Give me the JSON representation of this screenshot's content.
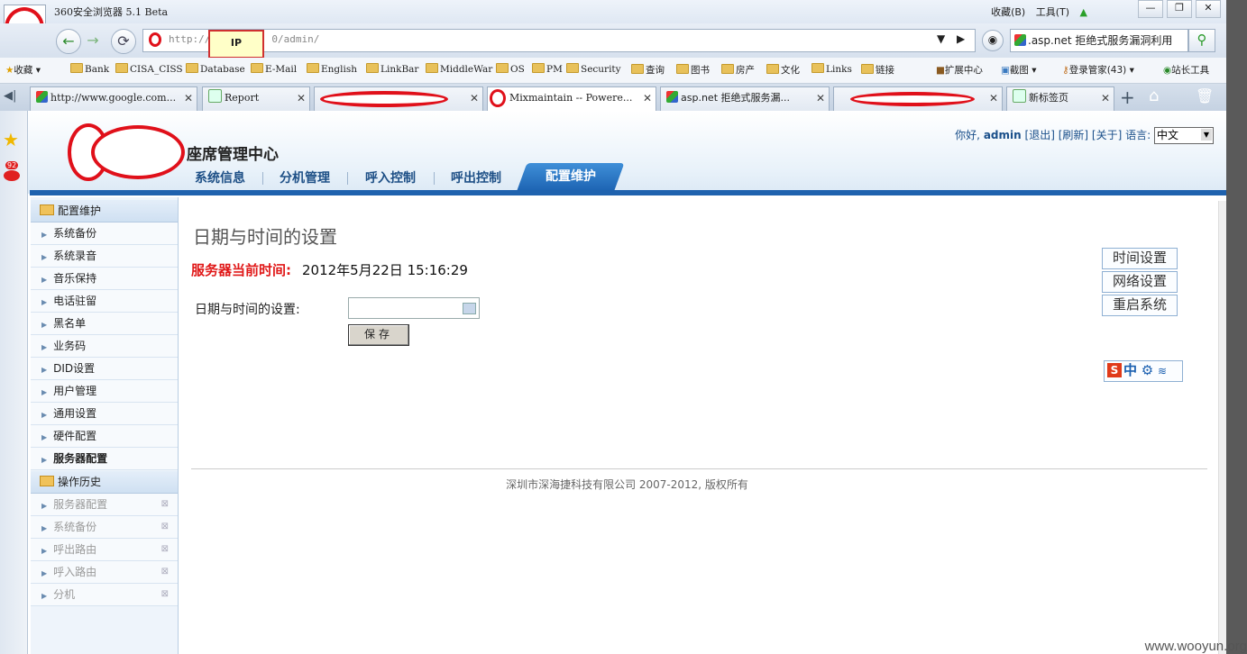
{
  "browser": {
    "title": "360安全浏览器 5.1 Beta",
    "menu": [
      "收藏(B)",
      "工具(T)"
    ],
    "address": "http://",
    "address_suffix": "0/admin/",
    "ip_tip": "IP",
    "search_text": ".asp.net 拒绝式服务漏洞利用"
  },
  "bookmarks": [
    "收藏",
    "Bank",
    "CISA_CISS",
    "Database",
    "E-Mail",
    "English",
    "LinkBar",
    "MiddleWar",
    "OS",
    "PM",
    "Security",
    "查询",
    "图书",
    "房产",
    "文化",
    "Links",
    "链接"
  ],
  "bookmarks_right": [
    "扩展中心",
    "截图",
    "登录管家(43)",
    "站长工具"
  ],
  "tabs": [
    {
      "label": "http://www.google.com..."
    },
    {
      "label": "Report"
    },
    {
      "label": ""
    },
    {
      "label": "Mixmaintain -- Powere..."
    },
    {
      "label": "asp.net 拒绝式服务漏..."
    },
    {
      "label": ""
    },
    {
      "label": "新标签页"
    }
  ],
  "badge": "92",
  "site": {
    "title": "座席管理中心",
    "greeting": "你好,",
    "user": "admin",
    "links": [
      "[退出]",
      "[刷新]",
      "[关于]"
    ],
    "lang_label": "语言:",
    "lang_value": "中文"
  },
  "nav": [
    "系统信息",
    "分机管理",
    "呼入控制",
    "呼出控制",
    "配置维护"
  ],
  "sidebar": {
    "section1": "配置维护",
    "items1": [
      "系统备份",
      "系统录音",
      "音乐保持",
      "电话驻留",
      "黑名单",
      "业务码",
      "DID设置",
      "用户管理",
      "通用设置",
      "硬件配置",
      "服务器配置"
    ],
    "section2": "操作历史",
    "items2": [
      "服务器配置",
      "系统备份",
      "呼出路由",
      "呼入路由",
      "分机"
    ]
  },
  "content": {
    "title": "日期与时间的设置",
    "server_time_label": "服务器当前时间:",
    "server_time": "2012年5月22日  15:16:29",
    "dt_label": "日期与时间的设置:",
    "save": "保存",
    "side_buttons": [
      "时间设置",
      "网络设置",
      "重启系统"
    ],
    "ime": "中"
  },
  "footer": "深圳市深海捷科技有限公司 2007-2012, 版权所有",
  "watermark": "www.wooyun.org"
}
